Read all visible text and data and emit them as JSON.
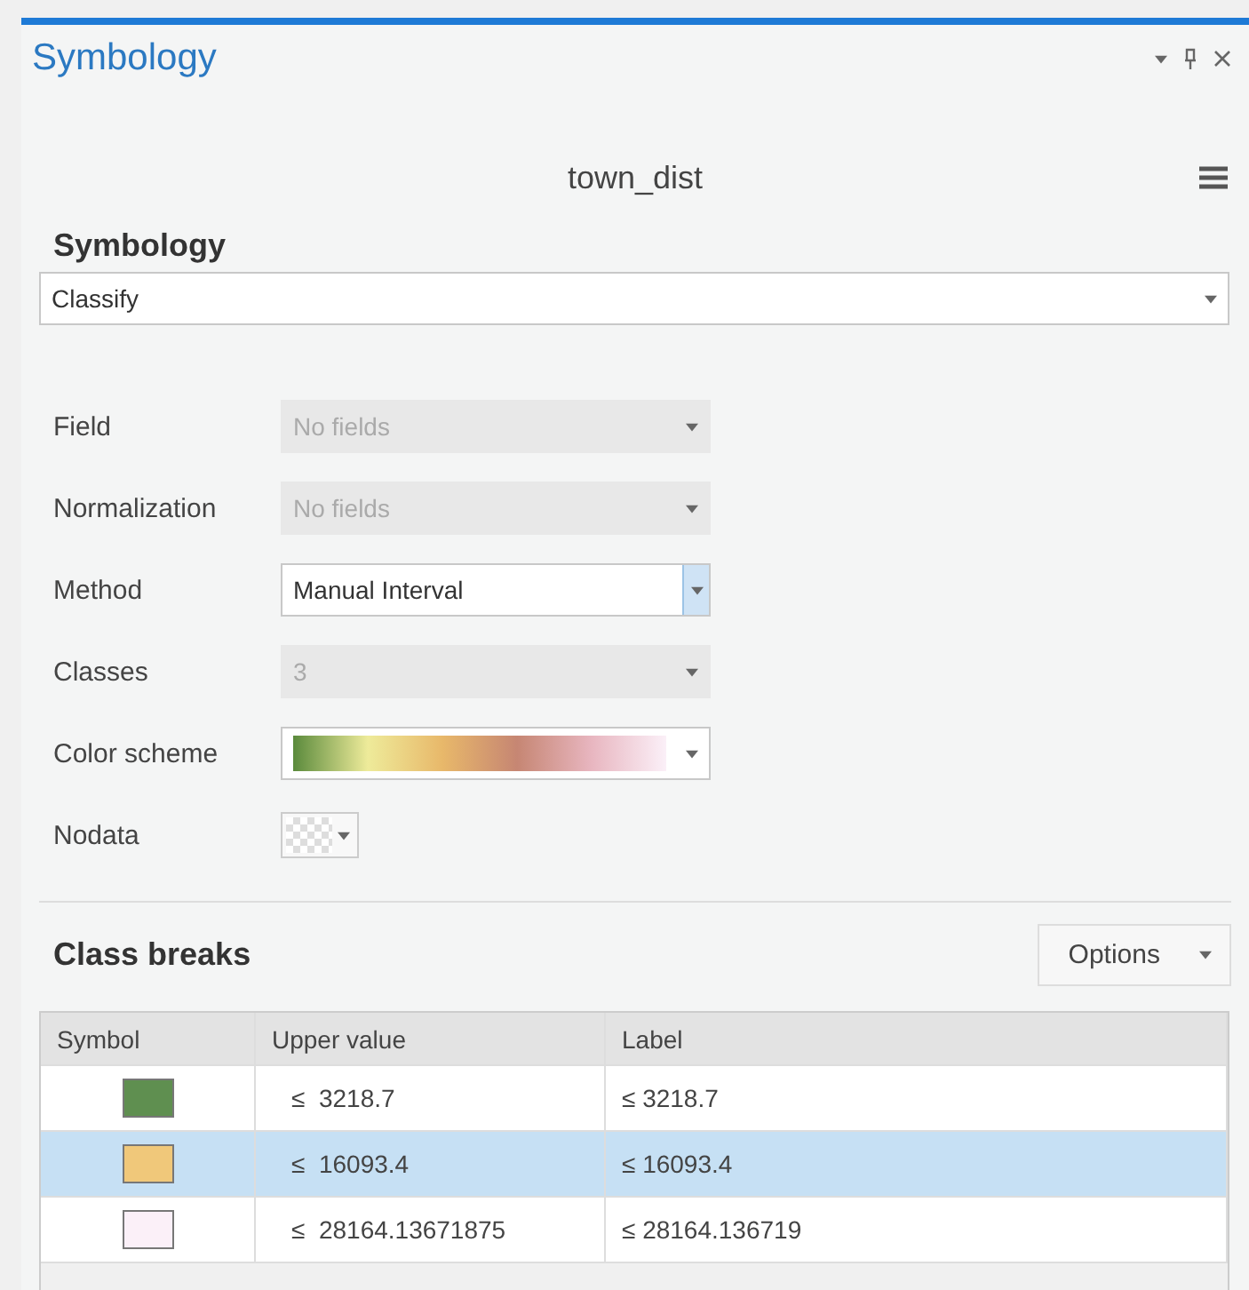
{
  "pane": {
    "title": "Symbology"
  },
  "layer": {
    "name": "town_dist"
  },
  "symbology": {
    "label": "Symbology",
    "value": "Classify"
  },
  "fields": [
    {
      "kind": "dropdown",
      "label": "Field",
      "value": "No fields",
      "disabled": true,
      "focused": false
    },
    {
      "kind": "dropdown",
      "label": "Normalization",
      "value": "No fields",
      "disabled": true,
      "focused": false
    },
    {
      "kind": "dropdown",
      "label": "Method",
      "value": "Manual Interval",
      "disabled": false,
      "focused": true
    },
    {
      "kind": "dropdown",
      "label": "Classes",
      "value": "3",
      "disabled": true,
      "focused": false
    },
    {
      "kind": "ramp",
      "label": "Color scheme"
    },
    {
      "kind": "swatch",
      "label": "Nodata"
    }
  ],
  "class_breaks": {
    "title": "Class breaks",
    "options_button": "Options",
    "columns": [
      "Symbol",
      "Upper value",
      "Label"
    ],
    "rows": [
      {
        "color": "#5f8f50",
        "upper": "≤  3218.7",
        "label": "≤ 3218.7",
        "selected": false
      },
      {
        "color": "#f0c87a",
        "upper": "≤  16093.4",
        "label": "≤ 16093.4",
        "selected": true
      },
      {
        "color": "#fbf0f8",
        "upper": "≤  28164.13671875",
        "label": "≤ 28164.136719",
        "selected": false
      }
    ]
  }
}
